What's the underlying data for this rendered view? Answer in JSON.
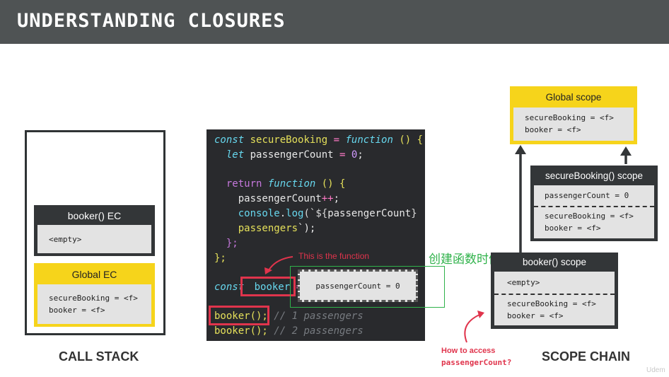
{
  "header": {
    "title": "UNDERSTANDING CLOSURES"
  },
  "call_stack": {
    "caption": "CALL STACK",
    "booker_ec": {
      "title": "booker() EC",
      "content": "<empty>"
    },
    "global_ec": {
      "title": "Global EC",
      "lines": [
        "secureBooking = <f>",
        "booker = <f>"
      ]
    }
  },
  "code": {
    "lines": [
      "const secureBooking = function () {",
      "  let passengerCount = 0;",
      "",
      "  return function () {",
      "    passengerCount++;",
      "    console.log(`${passengerCount}",
      "    passengers`);",
      "  };",
      "};",
      "const booker = ",
      "booker(); // 1 passengers",
      "booker(); // 2 passengers"
    ],
    "tokens": {
      "const": "const",
      "secureBooking": "secureBooking",
      "eq": "=",
      "function": "function",
      "paren_brace": "() {",
      "let": "let",
      "passengerCount": "passengerCount",
      "zero": "0",
      "semi": ";",
      "return": "return",
      "inc": "++",
      "console": "console",
      "log": "log",
      "tpl_open": "(`${",
      "tpl_close": "}",
      "passengers": "passengers",
      "tpl_end": "`);",
      "close_inner": "};",
      "close_outer": "};",
      "booker": "booker",
      "call": "booker();",
      "comment1": "// 1 passengers",
      "comment2": "// 2 passengers"
    },
    "variable_box": "passengerCount = 0"
  },
  "annotations": {
    "this_is_function": "This is the function",
    "chinese_note": "创建函数时候的变量",
    "how_to_access_1": "How to access",
    "how_to_access_2": "passengerCount?"
  },
  "scope_chain": {
    "caption": "SCOPE CHAIN",
    "global": {
      "title": "Global scope",
      "lines": [
        "secureBooking = <f>",
        "booker = <f>"
      ]
    },
    "secure_booking": {
      "title": "secureBooking() scope",
      "var": "passengerCount = 0",
      "lines": [
        "secureBooking = <f>",
        "booker = <f>"
      ]
    },
    "booker": {
      "title": "booker() scope",
      "empty": "<empty>",
      "lines": [
        "secureBooking = <f>",
        "booker = <f>"
      ]
    }
  },
  "colors": {
    "accent_yellow": "#f6d41b",
    "dark": "#333638",
    "red": "#e0344c",
    "green": "#2fb24a",
    "title_bg": "#4f5354"
  },
  "watermark": "Udem"
}
